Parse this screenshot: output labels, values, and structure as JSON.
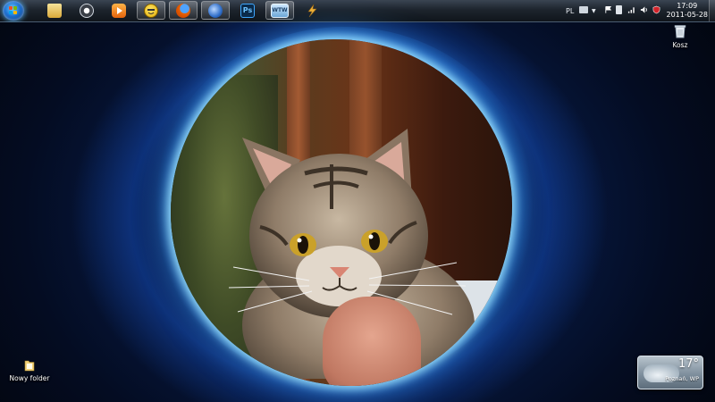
{
  "taskbar": {
    "pinned": [
      {
        "name": "windows-explorer",
        "active": false
      },
      {
        "name": "media-player-classic",
        "active": false
      },
      {
        "name": "windows-media-player",
        "active": false
      },
      {
        "name": "gadu-gadu",
        "active": true
      },
      {
        "name": "firefox",
        "active": true
      },
      {
        "name": "thunderbird",
        "active": true
      },
      {
        "name": "photoshop",
        "active": false
      },
      {
        "name": "wtw-app",
        "active": true
      },
      {
        "name": "winamp",
        "active": false
      }
    ],
    "language": "PL",
    "clock": {
      "time": "17:09",
      "date": "2011-05-28"
    }
  },
  "desktop": {
    "icons": [
      {
        "label": "Kosz",
        "icon": "recycle-bin-icon"
      },
      {
        "label": "Nowy folder",
        "icon": "folder-icon"
      }
    ]
  },
  "weather": {
    "temperature": "17°",
    "location": "Poznań, WP"
  },
  "colors": {
    "taskbar": "#1d242d",
    "portal_glow": "#5ac8ff",
    "background": "#071a44"
  }
}
